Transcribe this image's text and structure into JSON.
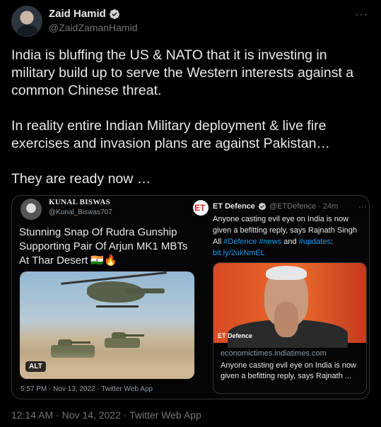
{
  "tweet": {
    "author_name": "Zaid Hamid",
    "author_handle": "@ZaidZamanHamid",
    "more_label": "···",
    "paragraphs": [
      "India is bluffing the US & NATO that it is investing in military build up to serve the Western interests against a common Chinese threat.",
      "In reality entire Indian Military deployment & live fire exercises and invasion plans are against Pakistan…",
      "They are ready now …"
    ],
    "timestamp": "12:14 AM · Nov 14, 2022 · Twitter Web App"
  },
  "quoted_left": {
    "author_name": "KUNAL BISWAS",
    "author_handle": "@Kunal_Biswas707",
    "text": "Stunning Snap Of Rudra Gunship Supporting Pair Of Arjun MK1 MBTs At Thar Desert 🇮🇳🔥",
    "alt_badge": "ALT",
    "meta": "5:57 PM · Nov 13, 2022 · Twitter Web App"
  },
  "quoted_right": {
    "author_name": "ET Defence",
    "author_handle": "@ETDefence · 24m",
    "more_label": "···",
    "text_main": "Anyone casting evil eye on India is now given a befitting reply, says Rajnath Singh All ",
    "hashtag_1": "#Defence",
    "text_and": " #news",
    "text_and_word": " and ",
    "hashtag_2": "#updates",
    "text_colon": ":",
    "link": "bit.ly/2ukNmEL",
    "card_tag": "ET Defence",
    "card_domain": "economictimes.indiatimes.com",
    "card_title": "Anyone casting evil eye on India is now given a befitting reply, says Rajnath ..."
  },
  "colors": {
    "background": "#000000",
    "text": "#e7e9ea",
    "muted": "#71767b",
    "link": "#1d9bf0",
    "verified_badge": "#d0d0d0",
    "border": "#2f3336"
  },
  "icons": {
    "verified": "verified-badge-icon",
    "more": "more-icon"
  }
}
